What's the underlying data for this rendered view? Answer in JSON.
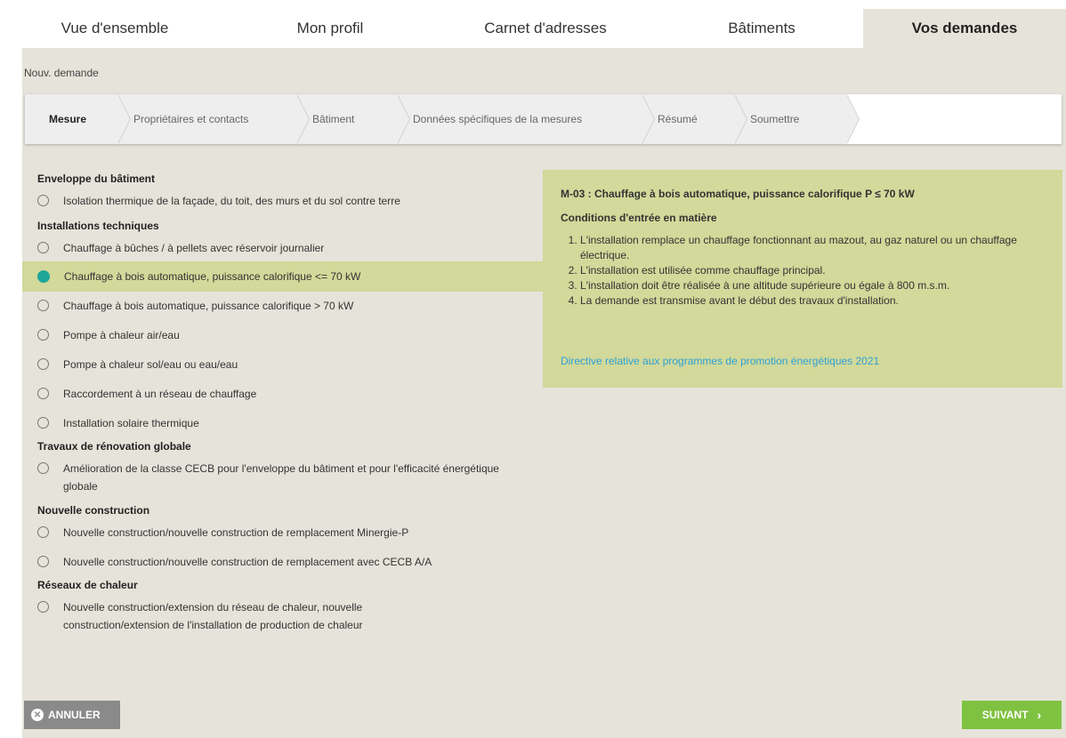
{
  "topnav": {
    "tabs": [
      {
        "label": "Vue d'ensemble"
      },
      {
        "label": "Mon profil"
      },
      {
        "label": "Carnet d'adresses"
      },
      {
        "label": "Bâtiments"
      },
      {
        "label": "Vos demandes"
      }
    ],
    "active": "Vos demandes"
  },
  "breadcrumb": "Nouv. demande",
  "wizard": {
    "steps": [
      {
        "label": "Mesure"
      },
      {
        "label": "Propriétaires et contacts"
      },
      {
        "label": "Bâtiment"
      },
      {
        "label": "Données spécifiques de la mesures"
      },
      {
        "label": "Résumé"
      },
      {
        "label": "Soumettre"
      }
    ],
    "active": "Mesure"
  },
  "measures": {
    "categories": [
      {
        "label": "Enveloppe du bâtiment",
        "options": [
          {
            "label": "Isolation thermique de la façade, du toit, des murs et du sol contre terre"
          }
        ]
      },
      {
        "label": "Installations techniques",
        "options": [
          {
            "label": "Chauffage à bûches / à pellets avec réservoir journalier"
          },
          {
            "label": "Chauffage à bois automatique, puissance calorifique <= 70 kW",
            "selected": true
          },
          {
            "label": "Chauffage à bois automatique, puissance calorifique > 70 kW"
          },
          {
            "label": "Pompe à chaleur air/eau"
          },
          {
            "label": "Pompe à chaleur sol/eau ou eau/eau"
          },
          {
            "label": "Raccordement à un réseau de chauffage"
          },
          {
            "label": "Installation solaire thermique"
          }
        ]
      },
      {
        "label": "Travaux de rénovation globale",
        "options": [
          {
            "label": "Amélioration de la classe CECB pour l'enveloppe du bâtiment et pour l'efficacité énergétique globale"
          }
        ]
      },
      {
        "label": "Nouvelle construction",
        "options": [
          {
            "label": "Nouvelle construction/nouvelle construction de remplacement Minergie-P"
          },
          {
            "label": "Nouvelle construction/nouvelle construction de remplacement avec CECB A/A"
          }
        ]
      },
      {
        "label": "Réseaux de chaleur",
        "options": [
          {
            "label": "Nouvelle construction/extension du réseau de chaleur, nouvelle construction/extension de l'installation de production de chaleur"
          }
        ]
      }
    ]
  },
  "info": {
    "title": "M-03 : Chauffage à bois automatique, puissance calorifique P ≤ 70 kW",
    "subtitle": "Conditions d'entrée en matière",
    "conditions": [
      "L'installation remplace un chauffage fonctionnant au mazout, au gaz naturel ou un chauffage électrique.",
      "L'installation est utilisée comme chauffage principal.",
      "L'installation doit être réalisée à une altitude supérieure ou égale à 800 m.s.m.",
      "La demande est transmise avant le début des travaux d'installation."
    ],
    "link": "Directive relative aux programmes de promotion énergétiques 2021"
  },
  "buttons": {
    "cancel": "ANNULER",
    "next": "SUIVANT"
  },
  "colors": {
    "background": "#e6e3da",
    "highlight": "#d2d99a",
    "radio_selected": "#1fa69a",
    "next_button": "#7fc241",
    "cancel_button": "#8a8a8a",
    "link": "#2ea0d6"
  }
}
